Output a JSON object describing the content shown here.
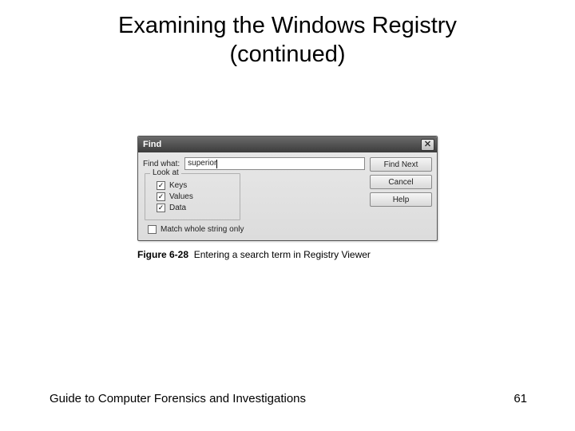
{
  "slide": {
    "title_line1": "Examining the Windows Registry",
    "title_line2": "(continued)"
  },
  "dialog": {
    "title": "Find",
    "close_glyph": "✕",
    "find_label": "Find what:",
    "find_value": "superior",
    "lookat_legend": "Look at",
    "chk_keys": "Keys",
    "chk_values": "Values",
    "chk_data": "Data",
    "chk_match": "Match whole string only",
    "checkmark": "✓",
    "buttons": {
      "find_next": "Find Next",
      "cancel": "Cancel",
      "help": "Help"
    }
  },
  "caption": {
    "label": "Figure 6-28",
    "text": "Entering a search term in Registry Viewer"
  },
  "footer": {
    "book": "Guide to Computer Forensics and Investigations",
    "page": "61"
  }
}
